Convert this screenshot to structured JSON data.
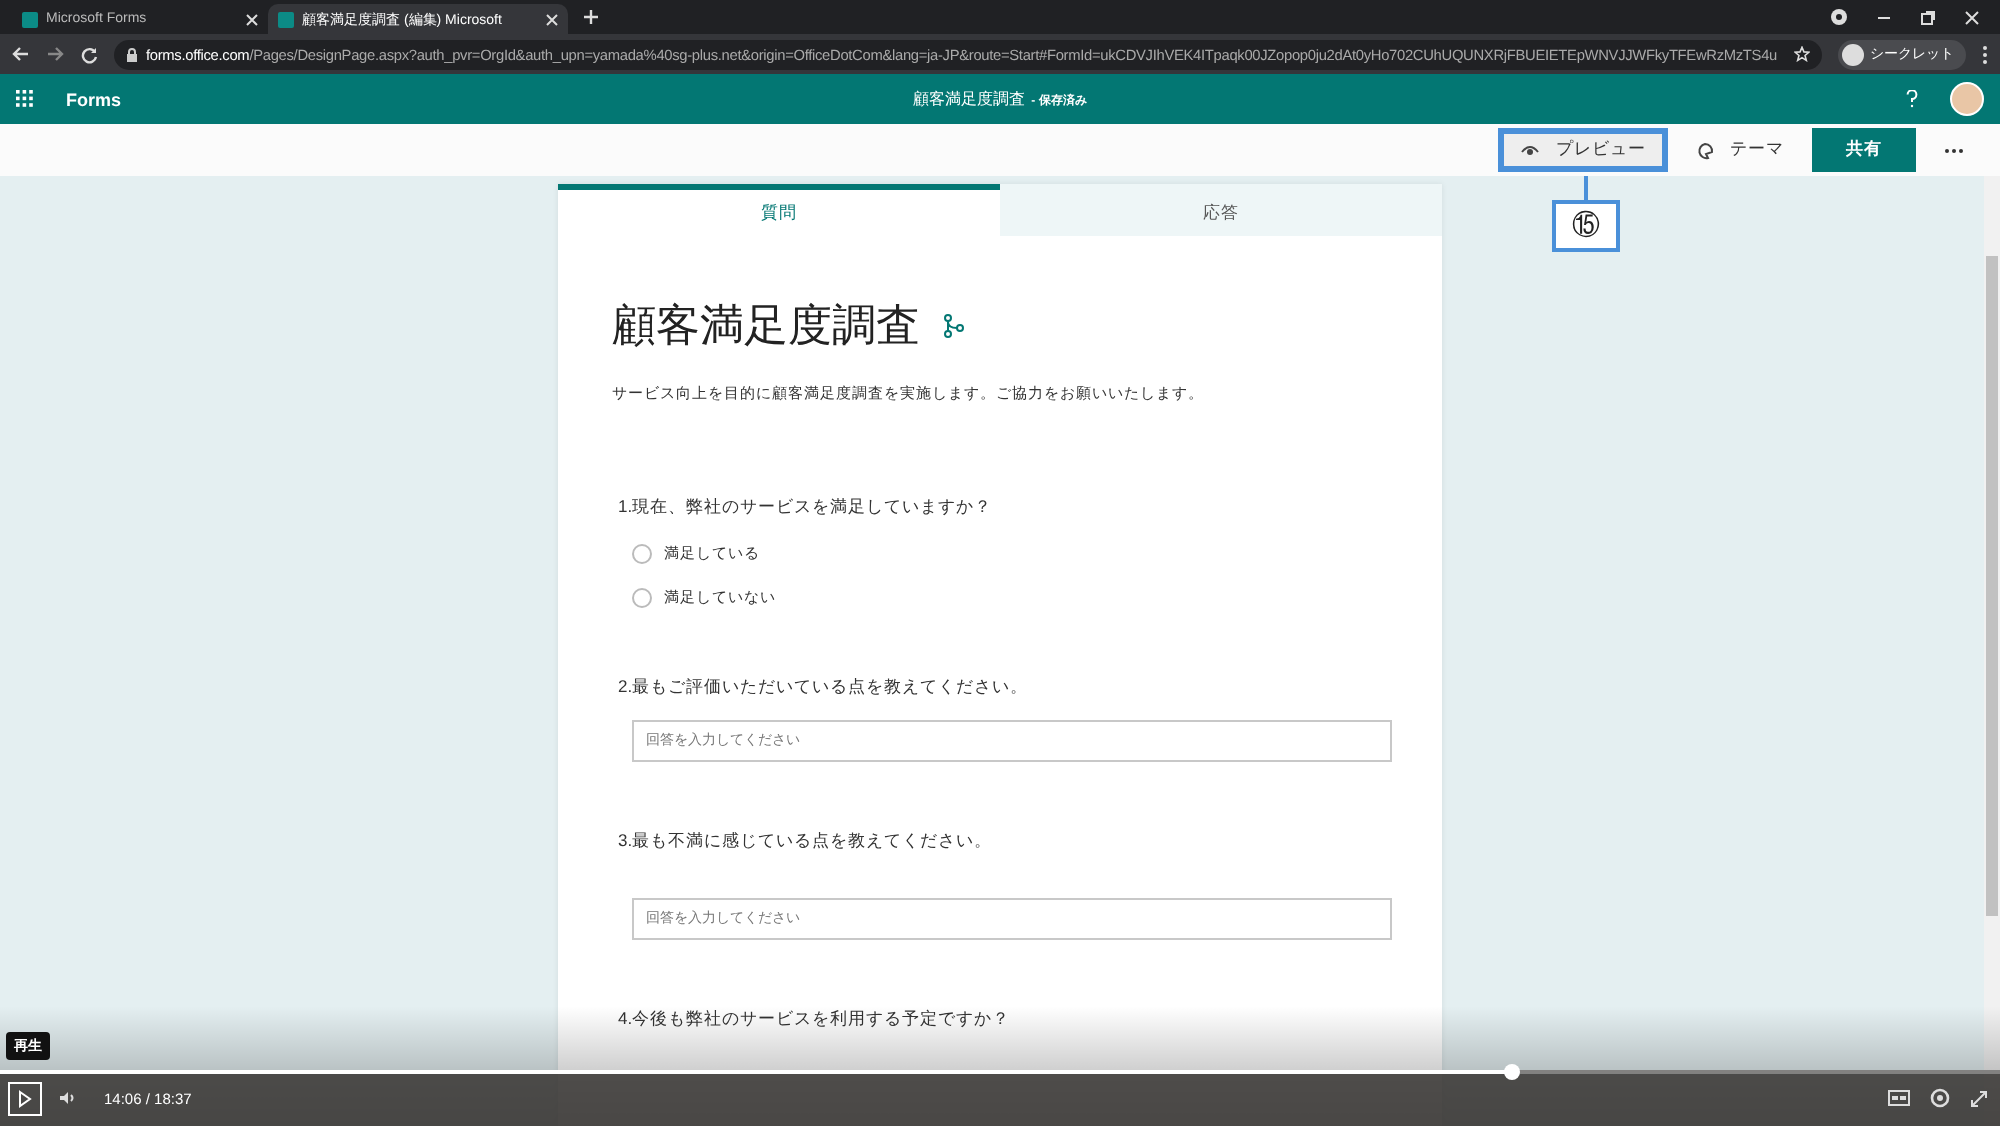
{
  "browser": {
    "tabs": [
      {
        "title": "Microsoft Forms",
        "selected": false
      },
      {
        "title": "顧客満足度調査 (編集) Microsoft",
        "selected": true
      }
    ],
    "url": "**forms.office.com**/Pages/DesignPage.aspx?auth_pvr=OrgId&auth_upn=yamada%40sg-plus.net&origin=OfficeDotCom&lang=ja-JP&route=Start#FormId=ukCDVJIhVEK4ITpaqk00JZopop0ju2dAt0yHo702CUhUQUNXRjFBUEIETEpWNVJJWFkyTFEwRzMzTS4u",
    "profile": "シークレット"
  },
  "app_header": {
    "app_name": "Forms",
    "form_title": "顧客満足度調査",
    "save_status": "- 保存済み"
  },
  "toolbar": {
    "buttons": [
      {
        "kind": "preview",
        "label": "プレビュー",
        "highlighted": true,
        "callout": "⑮"
      },
      {
        "kind": "theme",
        "label": "テーマ",
        "highlighted": false
      },
      {
        "kind": "share",
        "label": "共有",
        "highlighted": false
      },
      {
        "kind": "more",
        "highlighted": false
      }
    ]
  },
  "form": {
    "tabs": [
      {
        "label": "質問",
        "selected": true
      },
      {
        "label": "応答",
        "selected": false
      }
    ],
    "title": "顧客満足度調査",
    "description": "サービス向上を目的に顧客満足度調査を実施します。ご協力をお願いいたします。",
    "questions": [
      {
        "kind": "choice",
        "text": "1.現在、弊社のサービスを満足していますか？",
        "options": [
          {
            "label": "満足している",
            "selected": false
          },
          {
            "label": "満足していない",
            "selected": false
          }
        ]
      },
      {
        "kind": "text",
        "text": "2.最もご評価いただいている点を教えてください。",
        "placeholder": "回答を入力してください"
      },
      {
        "kind": "text",
        "text": "3.最も不満に感じている点を教えてください。",
        "placeholder": "回答を入力してください"
      },
      {
        "kind": "choice",
        "text": "4.今後も弊社のサービスを利用する予定ですか？"
      }
    ]
  },
  "player": {
    "tooltip": "再生",
    "time": "14:06 / 18:37",
    "level": 0.756
  }
}
